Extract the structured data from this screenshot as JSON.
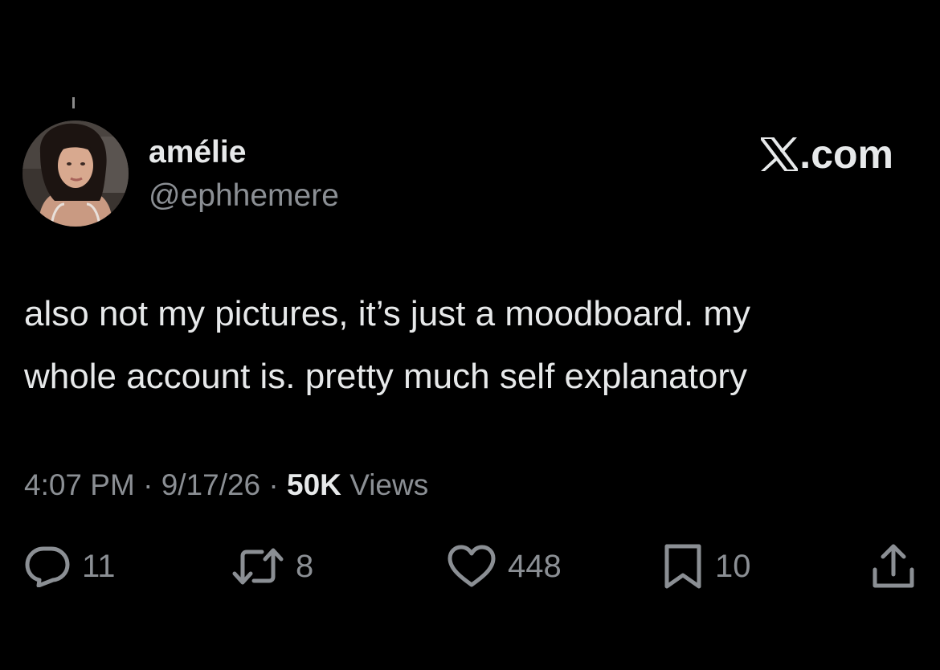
{
  "author": {
    "display_name": "amélie",
    "handle": "@ephhemere"
  },
  "brand": {
    "logo_icon": "x-logo-icon",
    "domain_text": ".com"
  },
  "tweet": {
    "lines": [
      "also not my pictures, it’s just a moodboard. my",
      "whole account is. pretty much self explanatory"
    ]
  },
  "meta": {
    "time": "4:07 PM",
    "separator": " · ",
    "date": "9/17/26",
    "views_count": "50K",
    "views_label": " Views"
  },
  "actions": {
    "replies": {
      "icon": "reply-icon",
      "count": "11"
    },
    "reposts": {
      "icon": "repost-icon",
      "count": "8"
    },
    "likes": {
      "icon": "heart-icon",
      "count": "448"
    },
    "bookmarks": {
      "icon": "bookmark-icon",
      "count": "10"
    },
    "share": {
      "icon": "share-icon"
    }
  },
  "colors": {
    "background": "#000000",
    "primary_text": "#e7e9ea",
    "secondary_text": "#8b8f94"
  }
}
